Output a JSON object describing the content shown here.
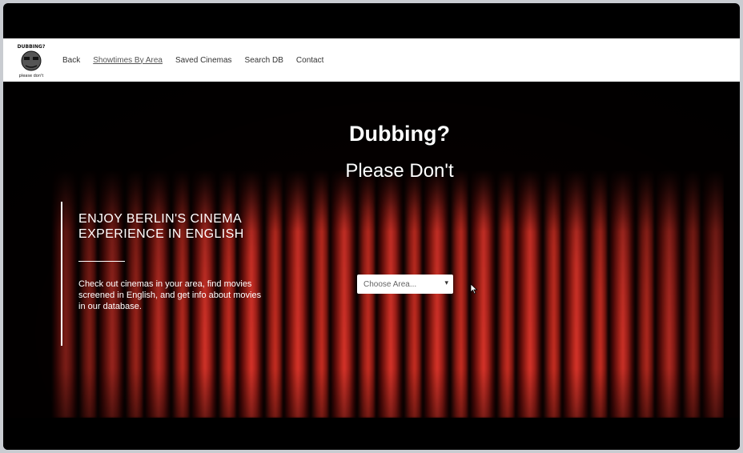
{
  "nav": {
    "logo_text_top": "DUBBING?",
    "logo_text_bottom": "please don't",
    "items": [
      {
        "label": "Back"
      },
      {
        "label": "Showtimes By Area",
        "active": true
      },
      {
        "label": "Saved Cinemas"
      },
      {
        "label": "Search DB"
      },
      {
        "label": "Contact"
      }
    ]
  },
  "hero": {
    "title_line1": "Dubbing?",
    "title_line2": "Please Don't",
    "tagline": "ENJOY BERLIN'S CINEMA EXPERIENCE IN ENGLISH",
    "description": "Check out cinemas in your area, find movies screened in English, and get info about movies in our database.",
    "select_placeholder": "Choose Area...",
    "select_arrow": "▾"
  },
  "colors": {
    "nav_bg": "#ffffff",
    "hero_bg": "#000000",
    "curtain": "#c92e22"
  }
}
